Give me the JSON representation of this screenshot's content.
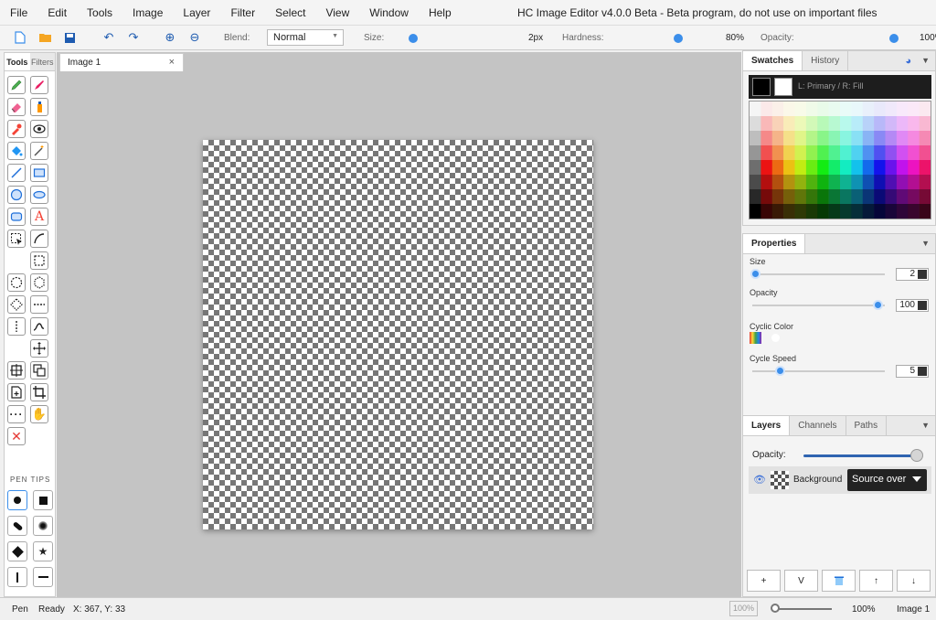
{
  "menu": [
    "File",
    "Edit",
    "Tools",
    "Image",
    "Layer",
    "Filter",
    "Select",
    "View",
    "Window",
    "Help"
  ],
  "app_title": "HC Image Editor v4.0.0 Beta - Beta program, do not use on important files",
  "toolbar": {
    "blend_label": "Blend:",
    "blend_value": "Normal",
    "size_label": "Size:",
    "size_value": "2px",
    "hardness_label": "Hardness:",
    "hardness_value": "80%",
    "opacity_label": "Opacity:",
    "opacity_value": "100%"
  },
  "left_tabs": [
    "Tools",
    "Filters"
  ],
  "pen_tips_label": "PEN TIPS",
  "document": {
    "tab_label": "Image 1",
    "close": "×"
  },
  "swatches": {
    "tabs": [
      "Swatches",
      "History"
    ],
    "primary_label": "L: Primary / R: Fill",
    "colors": {
      "primary": "#000000",
      "fill": "#ffffff"
    }
  },
  "properties": {
    "tab": "Properties",
    "size_label": "Size",
    "size_value": "2",
    "opacity_label": "Opacity",
    "opacity_value": "100",
    "cyclic_label": "Cyclic Color",
    "cycle_speed_label": "Cycle Speed",
    "cycle_speed_value": "5"
  },
  "layers": {
    "tabs": [
      "Layers",
      "Channels",
      "Paths"
    ],
    "opacity_label": "Opacity:",
    "opacity_level": 1.0,
    "layer_name": "Background",
    "layer_blend": "Source over",
    "buttons": [
      "+",
      "V",
      "trash-icon",
      "↑",
      "↓"
    ]
  },
  "status": {
    "tool": "Pen",
    "state": "Ready",
    "coords": "X: 367, Y: 33",
    "zoom_box": "100%",
    "zoom_value": "100%",
    "doc_name": "Image 1"
  },
  "accent_color": "#3b8eea"
}
